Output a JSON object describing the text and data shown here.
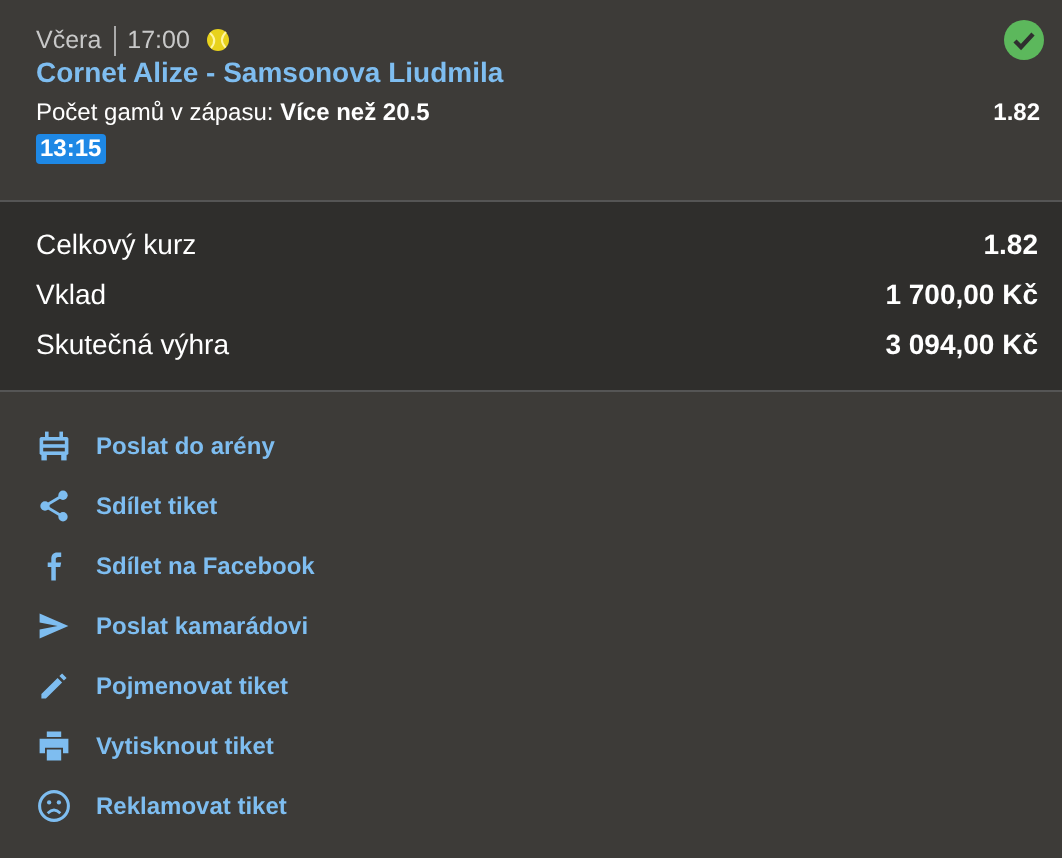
{
  "bet": {
    "day": "Včera",
    "time": "17:00",
    "won": true,
    "match": "Cornet Alize - Samsonova Liudmila",
    "market": "Počet gamů v zápasu: ",
    "pick": "Více než 20.5",
    "odds": "1.82",
    "live_time": "13:15"
  },
  "summary": [
    {
      "label": "Celkový kurz",
      "value": "1.82"
    },
    {
      "label": "Vklad",
      "value": "1 700,00 Kč"
    },
    {
      "label": "Skutečná výhra",
      "value": "3 094,00 Kč"
    }
  ],
  "actions": [
    {
      "kind": "arena",
      "label": "Poslat do arény"
    },
    {
      "kind": "share",
      "label": "Sdílet tiket"
    },
    {
      "kind": "facebook",
      "label": "Sdílet na Facebook"
    },
    {
      "kind": "send",
      "label": "Poslat kamarádovi"
    },
    {
      "kind": "edit",
      "label": "Pojmenovat tiket"
    },
    {
      "kind": "print",
      "label": "Vytisknout tiket"
    },
    {
      "kind": "complain",
      "label": "Reklamovat tiket"
    }
  ]
}
